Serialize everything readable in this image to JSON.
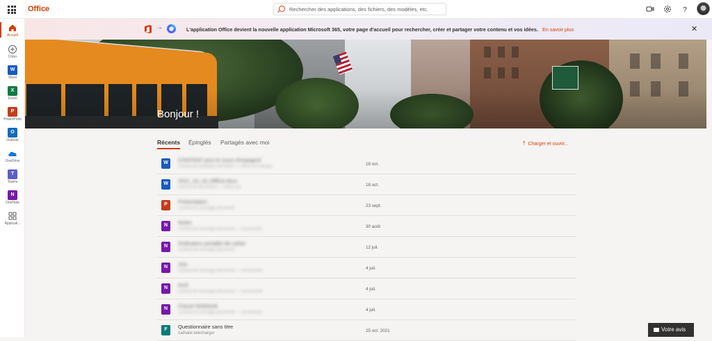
{
  "topbar": {
    "brand": "Office",
    "search_placeholder": "Rechercher des applications, des fichiers, des modèles, etc."
  },
  "sidebar": {
    "items": [
      {
        "label": "Accueil",
        "icon": "home-icon"
      },
      {
        "label": "Créer",
        "icon": "plus-circle-icon"
      },
      {
        "label": "Word",
        "icon": "word-icon",
        "letter": "W",
        "color": "#185abd"
      },
      {
        "label": "Excel",
        "icon": "excel-icon",
        "letter": "X",
        "color": "#107c41"
      },
      {
        "label": "PowerPoint",
        "icon": "powerpoint-icon",
        "letter": "P",
        "color": "#c43e1c"
      },
      {
        "label": "Outlook",
        "icon": "outlook-icon",
        "letter": "O",
        "color": "#0f6cbd"
      },
      {
        "label": "OneDrive",
        "icon": "onedrive-icon",
        "color": "#0f78d4"
      },
      {
        "label": "Teams",
        "icon": "teams-icon",
        "letter": "T",
        "color": "#5b5fc7"
      },
      {
        "label": "OneNote",
        "icon": "onenote-icon",
        "letter": "N",
        "color": "#7719aa"
      },
      {
        "label": "Applicati...",
        "icon": "apps-grid-icon"
      }
    ]
  },
  "banner": {
    "message": "L'application Office devient la nouvelle application Microsoft 365, votre page d'accueil pour rechercher, créer et partager votre contenu et vos idées.",
    "learn_more": "En savoir plus",
    "arrow": "→"
  },
  "hero": {
    "greeting": "Bonjour !"
  },
  "tabs": {
    "recent": "Récents",
    "pinned": "Épinglés",
    "shared": "Partagés avec moi"
  },
  "upload": {
    "label": "Charger et ouvrir..."
  },
  "files": [
    {
      "name": "CONTRAT pour le cours d'espagnol",
      "sub": "Contrat de quelques éléments — Office en français",
      "date": "18 oct.",
      "type": "word",
      "color": "#185abd",
      "letter": "W"
    },
    {
      "name": "2021_10_18_Offline.docx",
      "sub": "Contrat de document — Office fax",
      "date": "18 oct.",
      "type": "word",
      "color": "#185abd",
      "letter": "W"
    },
    {
      "name": "Présentation",
      "sub": "Contrat de stockage personnel",
      "date": "23 sept.",
      "type": "powerpoint",
      "color": "#c43e1c",
      "letter": "P"
    },
    {
      "name": "Notes",
      "sub": "Contrat de stockage personnel — Documents",
      "date": "30 août",
      "type": "onenote",
      "color": "#7719aa",
      "letter": "N"
    },
    {
      "name": "Ordinateur portable de cahier",
      "sub": "Contrat de stockage personnel",
      "date": "12 juil.",
      "type": "onenote",
      "color": "#7719aa",
      "letter": "N"
    },
    {
      "name": "Juin",
      "sub": "Contrat de stockage personnel — Documents",
      "date": "4 juil.",
      "type": "onenote",
      "color": "#7719aa",
      "letter": "N"
    },
    {
      "name": "Avril",
      "sub": "Contrat de stockage personnel — Documents",
      "date": "4 juil.",
      "type": "onenote",
      "color": "#7719aa",
      "letter": "N"
    },
    {
      "name": "Classe Notebook",
      "sub": "Contrat de stockage personnel — Documents",
      "date": "4 juil.",
      "type": "onenote",
      "color": "#7719aa",
      "letter": "N"
    },
    {
      "name": "Questionnaire sans titre",
      "sub": "nathalie.telecharger",
      "date": "25 oct. 2021",
      "type": "forms",
      "color": "#0b7a75",
      "letter": "F"
    }
  ],
  "feedback": {
    "label": "Votre avis"
  }
}
